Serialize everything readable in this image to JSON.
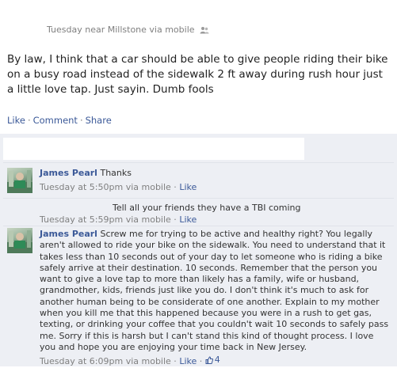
{
  "post": {
    "meta": "Tuesday near Millstone via mobile",
    "text": "By law, I think that a car should be able to give people riding their bike on a busy road instead of the sidewalk 2 ft away during rush hour just a little love tap. Just sayin. Dumb fools",
    "actions": {
      "like": "Like",
      "comment": "Comment",
      "share": "Share",
      "separator": "·"
    }
  },
  "comments": [
    {
      "author": "James Pearl",
      "text": "Thanks",
      "time": "Tuesday at 5:50pm via mobile",
      "like_label": "Like"
    },
    {
      "text": "Tell all your friends they have a TBI coming",
      "time": "Tuesday at 5:59pm via mobile",
      "like_label": "Like"
    },
    {
      "author": "James Pearl",
      "text": "Screw me for trying to be active and healthy right? You legally aren't allowed to ride your bike on the sidewalk. You need to understand that it takes less than 10 seconds out of your day to let someone who is riding a bike safely arrive at their destination. 10 seconds. Remember that the person you want to give a love tap to more than likely has a family, wife or husband, grandmother, kids, friends just like you do. I don't think it's much to ask for another human being to be considerate of one another. Explain to my mother when you kill me that this happened because you were in a rush to get gas, texting, or drinking your coffee that you couldn't wait 10 seconds to safely pass me. Sorry if this is harsh but I can't stand this kind of thought process. I love you and hope you are enjoying your time back in New Jersey.",
      "time": "Tuesday at 6:09pm via mobile",
      "like_label": "Like",
      "like_count": "4"
    }
  ],
  "icons": {
    "audience": "friends-icon",
    "likes": "thumbs-up-icon"
  },
  "colors": {
    "link": "#3b5998",
    "comment_bg": "#edeff4",
    "meta": "#808080"
  }
}
